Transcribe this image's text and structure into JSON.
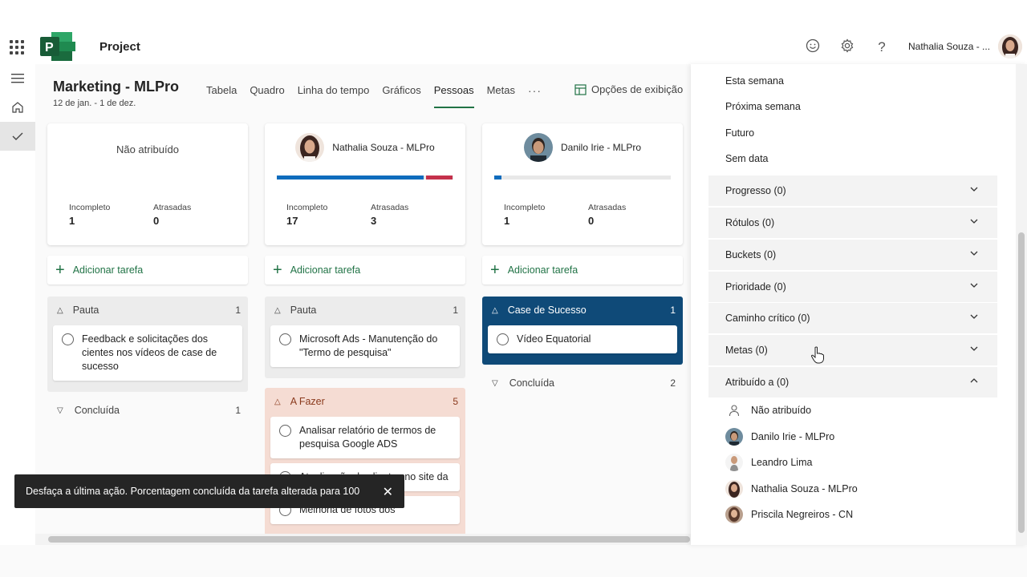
{
  "app": {
    "name": "Project",
    "user_name": "Nathalia Souza - ..."
  },
  "topbar_icons": [
    "emoji-icon",
    "gear-icon",
    "help-icon"
  ],
  "project": {
    "title": "Marketing - MLPro",
    "dates": "12 de jan. - 1 de dez."
  },
  "tabs": [
    "Tabela",
    "Quadro",
    "Linha do tempo",
    "Gráficos",
    "Pessoas",
    "Metas"
  ],
  "active_tab": "Pessoas",
  "tab_more": "···",
  "view_options": "Opções de exibição",
  "colors": {
    "brand_green": "#217346",
    "progress_blue": "#0f6cbd",
    "late_red": "#c4314b",
    "highlight_bucket": "#0f4a78",
    "todo_bucket": "#f5dcd3"
  },
  "columns": [
    {
      "name": "Não atribuído",
      "incomplete_label": "Incompleto",
      "incomplete": "1",
      "late_label": "Atrasadas",
      "late": "0",
      "add_task": "Adicionar tarefa",
      "bucket": {
        "name": "Pauta",
        "count": "1",
        "tasks": [
          "Feedback e solicitações dos cientes nos vídeos de case de sucesso"
        ]
      },
      "done": {
        "label": "Concluída",
        "count": "1"
      }
    },
    {
      "name": "Nathalia Souza - MLPro",
      "progress": {
        "complete_fraction": 0.85,
        "late_fraction": 0.15
      },
      "incomplete_label": "Incompleto",
      "incomplete": "17",
      "late_label": "Atrasadas",
      "late": "3",
      "add_task": "Adicionar tarefa",
      "bucket": {
        "name": "Pauta",
        "count": "1",
        "tasks": [
          "Microsoft Ads - Manutenção do \"Termo de pesquisa\""
        ]
      },
      "bucket2": {
        "name": "A Fazer",
        "count": "5",
        "tasks": [
          "Analisar relatório de termos de pesquisa Google ADS",
          "Atualização de clientes no site da",
          "Melhoria de fotos dos"
        ]
      }
    },
    {
      "name": "Danilo Irie - MLPro",
      "progress": {
        "complete_fraction": 0.04,
        "late_fraction": 0
      },
      "incomplete_label": "Incompleto",
      "incomplete": "1",
      "late_label": "Atrasadas",
      "late": "0",
      "add_task": "Adicionar tarefa",
      "bucket": {
        "name": "Case de Sucesso",
        "count": "1",
        "tasks": [
          "Vídeo Equatorial"
        ]
      },
      "done": {
        "label": "Concluída",
        "count": "2"
      }
    }
  ],
  "toast": {
    "message": "Desfaça a última ação. Porcentagem concluída da tarefa alterada para 100"
  },
  "filter_panel": {
    "date_options": [
      "Esta semana",
      "Próxima semana",
      "Futuro",
      "Sem data"
    ],
    "sections": [
      "Progresso (0)",
      "Rótulos (0)",
      "Buckets (0)",
      "Prioridade (0)",
      "Caminho crítico (0)",
      "Metas (0)",
      "Atribuído a (0)"
    ],
    "assignees": [
      "Não atribuído",
      "Danilo Irie - MLPro",
      "Leandro Lima",
      "Nathalia Souza - MLPro",
      "Priscila Negreiros - CN"
    ]
  }
}
